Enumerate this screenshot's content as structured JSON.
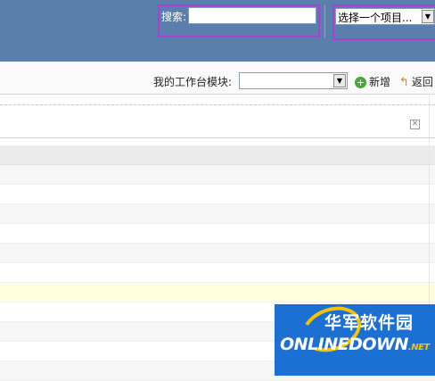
{
  "header": {
    "search_label": "搜索:",
    "search_value": "",
    "project_select_value": "选择一个项目..."
  },
  "toolbar": {
    "module_label": "我的工作台模块:",
    "module_select_value": "",
    "add_label": "新增",
    "back_label": "返回"
  },
  "grid": {
    "row_count": 12,
    "selected_row_index": 7
  },
  "watermark": {
    "cn_text": "华军软件园",
    "en_text": "ONLINEDOWN",
    "suffix": ".NET"
  },
  "colors": {
    "header_bg": "#5a7fad",
    "highlight": "#b03cd6",
    "selected_row": "#ffffe0",
    "watermark_bg": "#1c6fd3"
  }
}
